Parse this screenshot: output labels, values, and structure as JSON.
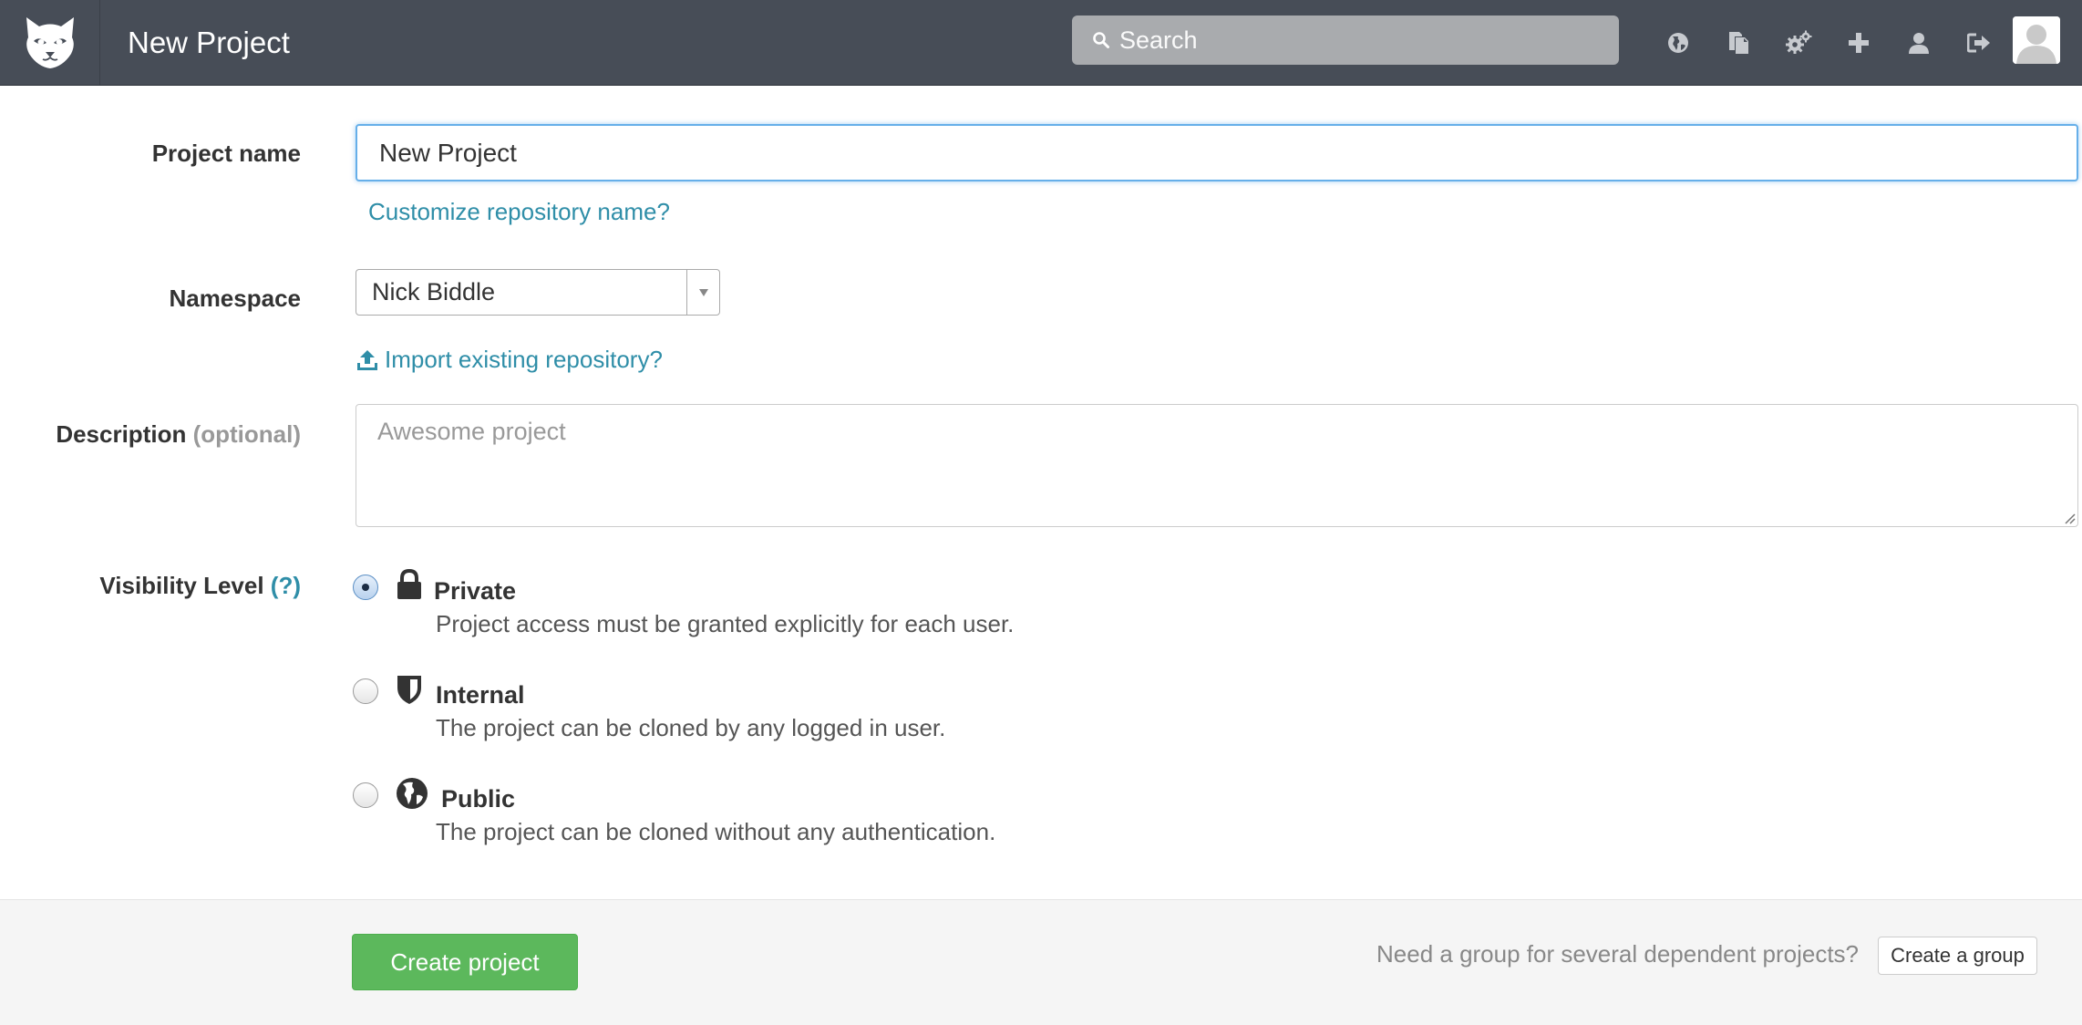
{
  "header": {
    "title": "New Project",
    "search_placeholder": "Search",
    "nav_icons": [
      "globe-icon",
      "copy-icon",
      "admin-gears-icon",
      "plus-icon",
      "user-icon",
      "sign-out-icon"
    ]
  },
  "form": {
    "project_name": {
      "label": "Project name",
      "value": "New Project",
      "customize_link": "Customize repository name?"
    },
    "namespace": {
      "label": "Namespace",
      "selected": "Nick Biddle",
      "import_link": "Import existing repository?"
    },
    "description": {
      "label": "Description",
      "label_suffix": "(optional)",
      "placeholder": "Awesome project"
    },
    "visibility": {
      "label": "Visibility Level",
      "help": "(?)",
      "options": [
        {
          "title": "Private",
          "description": "Project access must be granted explicitly for each user.",
          "checked": true,
          "icon": "lock-icon"
        },
        {
          "title": "Internal",
          "description": "The project can be cloned by any logged in user.",
          "checked": false,
          "icon": "shield-icon"
        },
        {
          "title": "Public",
          "description": "The project can be cloned without any authentication.",
          "checked": false,
          "icon": "globe-icon"
        }
      ]
    }
  },
  "footer": {
    "create_button": "Create project",
    "group_prompt": "Need a group for several dependent projects?",
    "group_button": "Create a group"
  },
  "colors": {
    "header_bg": "#474d57",
    "link": "#2f8ea8",
    "primary_green": "#5cb85c",
    "focus_blue": "#66afe9"
  }
}
